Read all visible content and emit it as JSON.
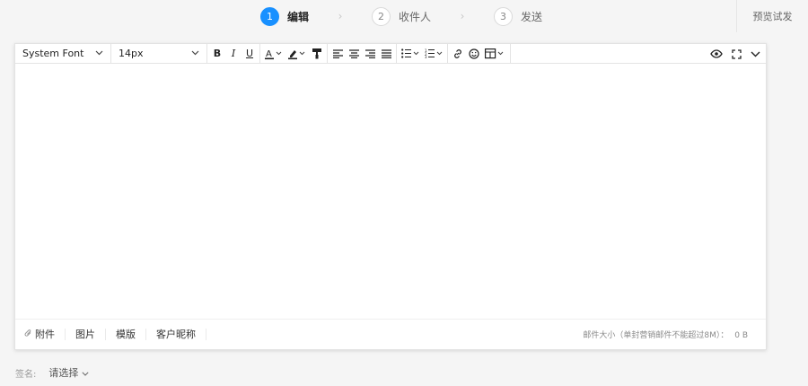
{
  "steps": [
    {
      "num": "1",
      "label": "编辑",
      "active": true
    },
    {
      "num": "2",
      "label": "收件人",
      "active": false
    },
    {
      "num": "3",
      "label": "发送",
      "active": false
    }
  ],
  "preview_label": "预览试发",
  "toolbar": {
    "font_family": "System Font",
    "font_size": "14px"
  },
  "footer": {
    "attachment": "附件",
    "image": "图片",
    "template": "模版",
    "nickname": "客户昵称",
    "size_note": "邮件大小（单封营销邮件不能超过8M）：",
    "size_value": "0 B"
  },
  "signature": {
    "label": "签名:",
    "placeholder": "请选择"
  },
  "colors": {
    "accent": "#1890ff"
  }
}
